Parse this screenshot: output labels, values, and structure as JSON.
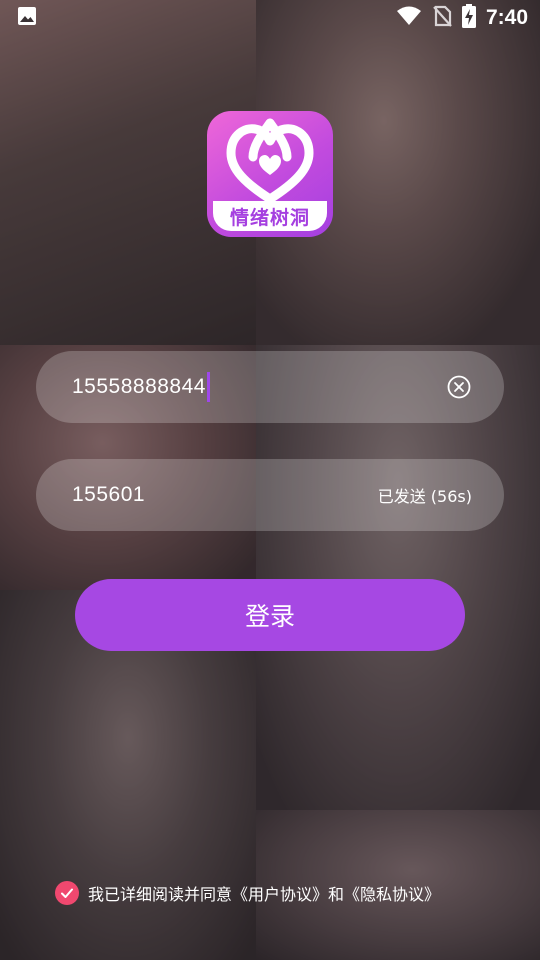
{
  "status_bar": {
    "time": "7:40",
    "icons": [
      "image-icon",
      "wifi-icon",
      "no-sim-icon",
      "battery-charging-icon"
    ]
  },
  "logo": {
    "text": "情绪树洞",
    "icon": "heart-icon",
    "gradient": [
      "#ef67d8",
      "#a43fe0"
    ]
  },
  "phone_field": {
    "value": "15558888844",
    "clear_icon": "clear-circle-icon"
  },
  "code_field": {
    "value": "155601",
    "resend_label": "已发送 (56s)"
  },
  "login_button": {
    "label": "登录",
    "color": "#a648e3"
  },
  "agreement": {
    "checked": true,
    "check_color": "#f0486f",
    "prefix": "我已详细阅读并同意",
    "user_agreement": "《用户协议》",
    "connector": "和",
    "privacy_agreement": "《隐私协议》"
  }
}
